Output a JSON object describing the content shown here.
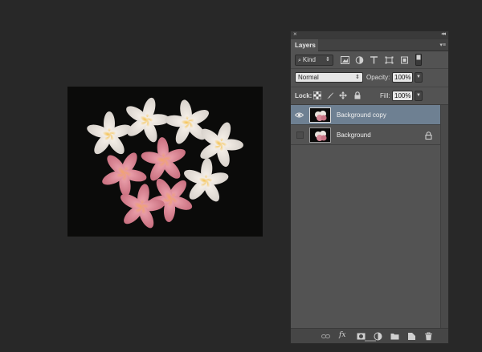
{
  "panel": {
    "close_glyph": "×",
    "collapse_glyph": "◂◂",
    "tab_label": "Layers",
    "menu_glyph": "▾≡"
  },
  "filter": {
    "kind_label": "Kind",
    "icons": [
      "pixel-filter-icon",
      "adjustment-filter-icon",
      "type-filter-icon",
      "shape-filter-icon",
      "smart-object-filter-icon",
      "filter-toggle-icon"
    ]
  },
  "blend": {
    "mode": "Normal",
    "opacity_label": "Opacity:",
    "opacity_value": "100%"
  },
  "lock": {
    "label": "Lock:",
    "icons": [
      "lock-transparent-pixels-icon",
      "lock-image-pixels-icon",
      "lock-position-icon",
      "lock-all-icon"
    ],
    "fill_label": "Fill:",
    "fill_value": "100%"
  },
  "layers": [
    {
      "name": "Background copy",
      "visible": true,
      "selected": true,
      "locked": false
    },
    {
      "name": "Background",
      "visible": false,
      "selected": false,
      "locked": true
    }
  ],
  "bottom_icons": [
    "link-layers-icon",
    "fx-icon",
    "add-mask-icon",
    "adjustment-layer-icon",
    "new-group-icon",
    "new-layer-icon",
    "delete-layer-icon"
  ],
  "bottom_fx_label": "fx",
  "colors": {
    "app_bg": "#282828",
    "panel_bg": "#535353",
    "selected_layer": "#6e8092"
  }
}
